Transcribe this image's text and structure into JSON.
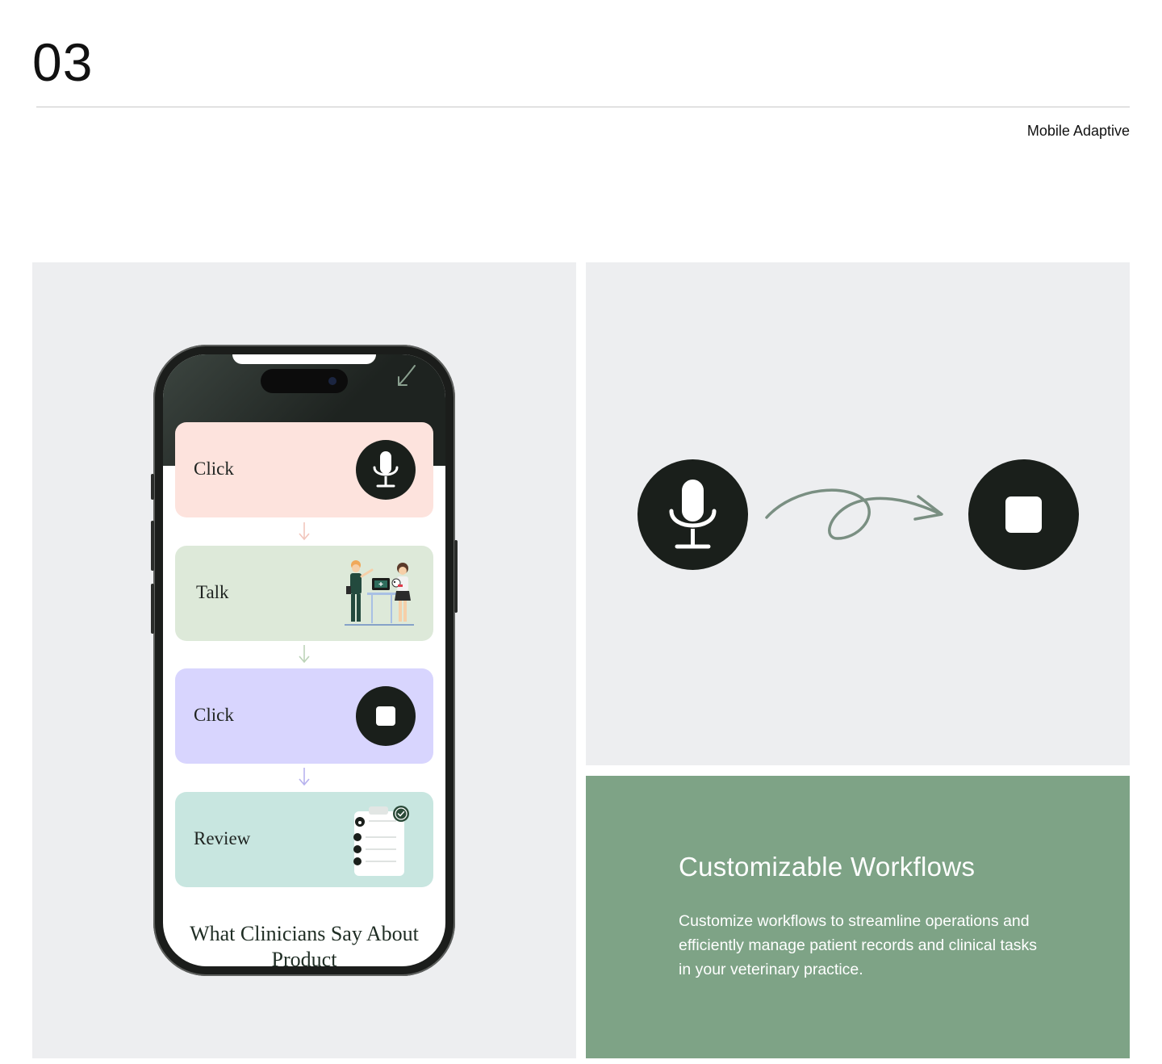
{
  "section": {
    "number": "03",
    "tag": "Mobile Adaptive"
  },
  "phone": {
    "cards": [
      {
        "label": "Click",
        "bg": "#fde3dd",
        "icon": "microphone-icon",
        "arrow_color": "#f2c6bd"
      },
      {
        "label": "Talk",
        "bg": "#dde9d9",
        "icon": "clinician-illustration",
        "arrow_color": "#bcd3b8"
      },
      {
        "label": "Click",
        "bg": "#d8d5fe",
        "icon": "stop-icon",
        "arrow_color": "#b7b2ee"
      },
      {
        "label": "Review",
        "bg": "#c8e6e0",
        "icon": "clipboard-checklist-icon"
      }
    ],
    "clinicians_title": "What Clinicians Say About Product"
  },
  "flow": {
    "from_icon": "microphone-icon",
    "connector_icon": "curved-arrow-icon",
    "to_icon": "stop-icon"
  },
  "feature": {
    "title": "Customizable Workflows",
    "description": "Customize workflows to streamline operations and efficiently manage patient records and clinical tasks in your veterinary practice."
  },
  "colors": {
    "panel_gray": "#edeef0",
    "feature_green": "#7ea386",
    "icon_dark": "#1a1f1b"
  }
}
